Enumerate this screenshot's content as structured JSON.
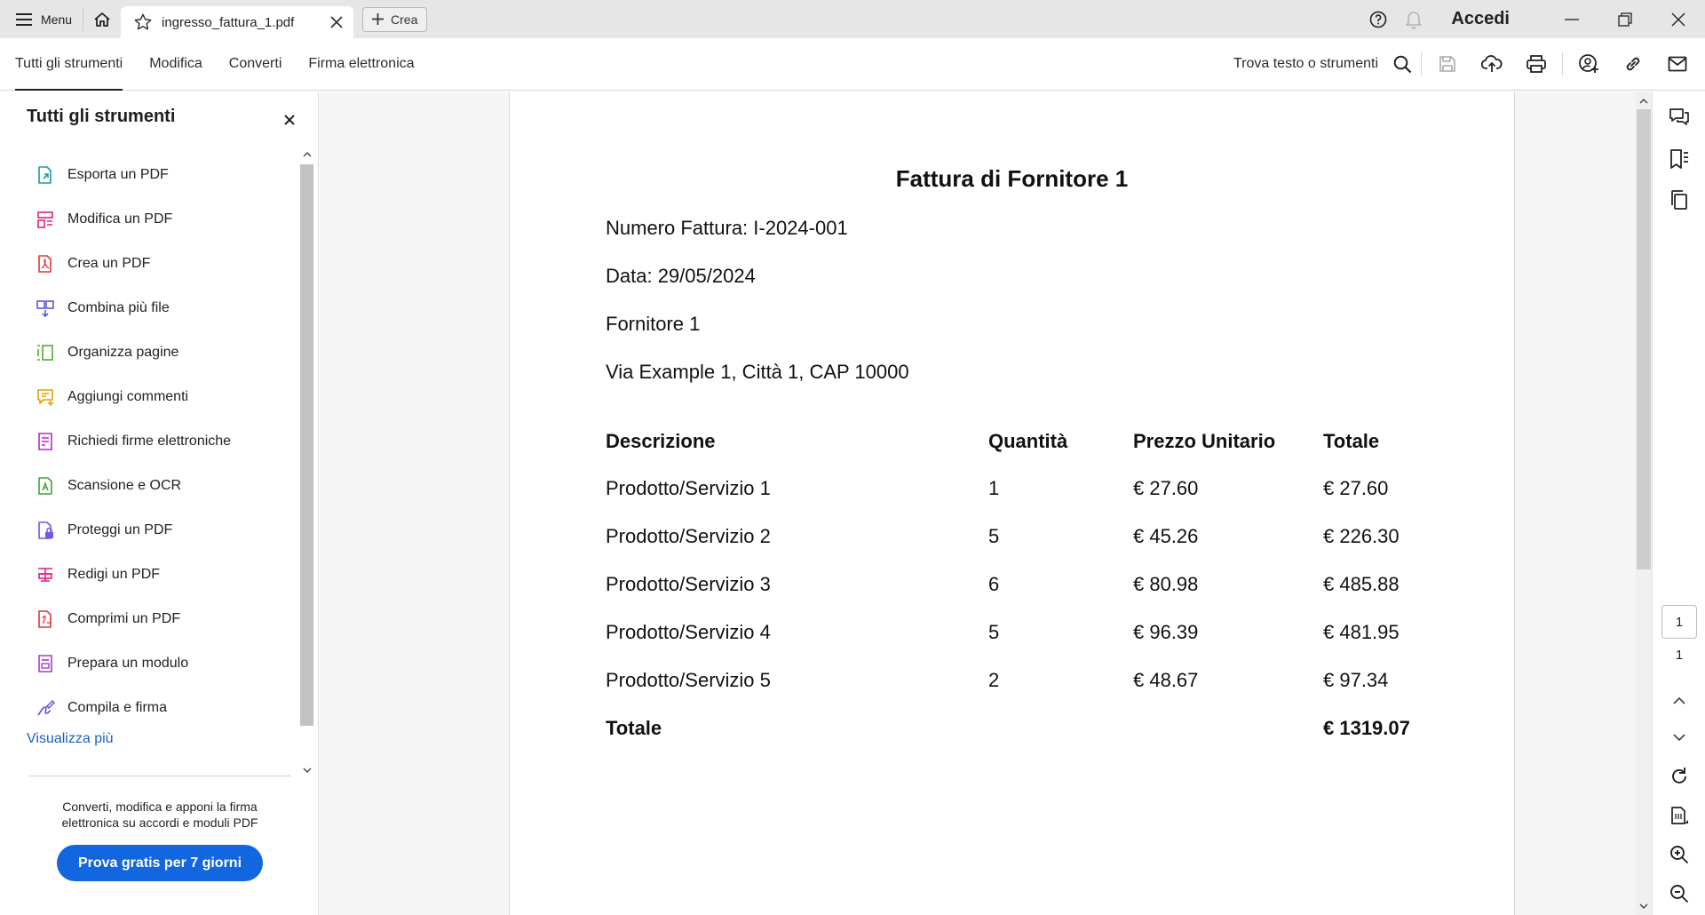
{
  "titlebar": {
    "menu_label": "Menu",
    "tab_title": "ingresso_fattura_1.pdf",
    "new_tab_label": "Crea",
    "signin_label": "Accedi"
  },
  "toolbar": {
    "tabs": [
      "Tutti gli strumenti",
      "Modifica",
      "Converti",
      "Firma elettronica"
    ],
    "find_label": "Trova testo o strumenti"
  },
  "left_panel": {
    "title": "Tutti gli strumenti",
    "tools": [
      {
        "label": "Esporta un PDF",
        "icon": "export-pdf-icon",
        "color": "#1a9e94"
      },
      {
        "label": "Modifica un PDF",
        "icon": "edit-pdf-icon",
        "color": "#e0217a"
      },
      {
        "label": "Crea un PDF",
        "icon": "create-pdf-icon",
        "color": "#e0343a"
      },
      {
        "label": "Combina più file",
        "icon": "combine-files-icon",
        "color": "#5b57e0"
      },
      {
        "label": "Organizza pagine",
        "icon": "organize-pages-icon",
        "color": "#4caf2a"
      },
      {
        "label": "Aggiungi commenti",
        "icon": "add-comment-icon",
        "color": "#d8a400"
      },
      {
        "label": "Richiedi firme elettroniche",
        "icon": "request-signatures-icon",
        "color": "#b02cc4"
      },
      {
        "label": "Scansione e OCR",
        "icon": "scan-ocr-icon",
        "color": "#3ba53b"
      },
      {
        "label": "Proteggi un PDF",
        "icon": "protect-pdf-icon",
        "color": "#6a5be2"
      },
      {
        "label": "Redigi un PDF",
        "icon": "redact-pdf-icon",
        "color": "#e0217a"
      },
      {
        "label": "Comprimi un PDF",
        "icon": "compress-pdf-icon",
        "color": "#e0343a"
      },
      {
        "label": "Prepara un modulo",
        "icon": "prepare-form-icon",
        "color": "#a43cc9"
      },
      {
        "label": "Compila e firma",
        "icon": "fill-sign-icon",
        "color": "#6a4ed6"
      }
    ],
    "see_more": "Visualizza più",
    "promo_text": "Converti, modifica e apponi la firma elettronica su accordi e moduli PDF",
    "promo_button": "Prova gratis per 7 giorni"
  },
  "document": {
    "title": "Fattura di Fornitore 1",
    "invoice_number": "Numero Fattura: I-2024-001",
    "date": "Data: 29/05/2024",
    "supplier": "Fornitore 1",
    "address": "Via Example 1, Città 1, CAP 10000",
    "table": {
      "headers": [
        "Descrizione",
        "Quantità",
        "Prezzo Unitario",
        "Totale"
      ],
      "rows": [
        [
          "Prodotto/Servizio 1",
          "1",
          "€ 27.60",
          "€ 27.60"
        ],
        [
          "Prodotto/Servizio 2",
          "5",
          "€ 45.26",
          "€ 226.30"
        ],
        [
          "Prodotto/Servizio 3",
          "6",
          "€ 80.98",
          "€ 485.88"
        ],
        [
          "Prodotto/Servizio 4",
          "5",
          "€ 96.39",
          "€ 481.95"
        ],
        [
          "Prodotto/Servizio 5",
          "2",
          "€ 48.67",
          "€ 97.34"
        ]
      ],
      "total_label": "Totale",
      "total_value": "€ 1319.07"
    }
  },
  "pager": {
    "current": "1",
    "total": "1"
  },
  "colors": {
    "accent": "#1266e0",
    "link": "#1a60c9"
  }
}
